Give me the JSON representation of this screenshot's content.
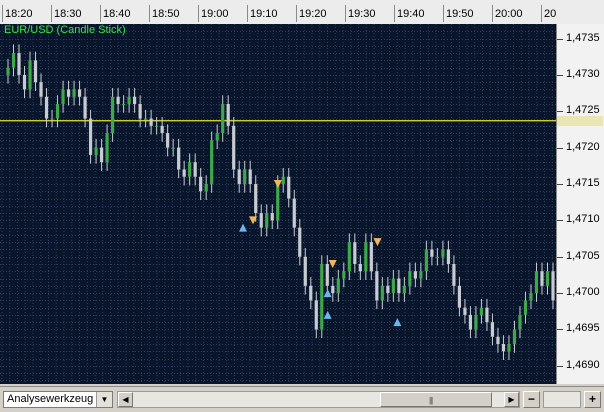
{
  "toolbar": {
    "analysis_tool": "Analysewerkzeug"
  },
  "colors": {
    "background": "#08152b",
    "grid": "#2e3e5c",
    "bull": "#3ea84a",
    "bear": "#c8ccd2",
    "hline": "#e6e62a",
    "title": "#3fe23f",
    "arrow_up": "#6fb4ec",
    "arrow_down": "#f0b65a"
  },
  "chart_data": {
    "type": "candlestick",
    "title": "EUR/USD (Candle Stick)",
    "x_ticks": [
      "18:20",
      "18:30",
      "18:40",
      "18:50",
      "19:00",
      "19:10",
      "19:20",
      "19:30",
      "19:40",
      "19:50",
      "20:00",
      "20"
    ],
    "y_ticks": [
      "1,4735",
      "1,4730",
      "1,4725",
      "1,4720",
      "1,4715",
      "1,4710",
      "1,4705",
      "1,4700",
      "1,4695",
      "1,4690"
    ],
    "ylim": [
      1.46875,
      1.4737
    ],
    "time_range": [
      "18:20",
      "20:00"
    ],
    "horizontal_line": 1.47237,
    "grid": true,
    "close": [
      1.4731,
      1.4733,
      1.473,
      1.4728,
      1.4732,
      1.4729,
      1.4727,
      1.4724,
      1.4724,
      1.4726,
      1.4728,
      1.4727,
      1.4728,
      1.4727,
      1.4724,
      1.4719,
      1.472,
      1.4718,
      1.4722,
      1.4727,
      1.4726,
      1.4726,
      1.4727,
      1.4726,
      1.4724,
      1.4724,
      1.4723,
      1.4723,
      1.4722,
      1.472,
      1.472,
      1.4717,
      1.4716,
      1.4718,
      1.4716,
      1.4714,
      1.4715,
      1.4721,
      1.4722,
      1.4726,
      1.4723,
      1.4717,
      1.4715,
      1.4717,
      1.4715,
      1.4711,
      1.4709,
      1.4711,
      1.471,
      1.4715,
      1.4716,
      1.4713,
      1.4709,
      1.4705,
      1.4701,
      1.4699,
      1.4695,
      1.4704,
      1.4701,
      1.47,
      1.4702,
      1.4703,
      1.4707,
      1.4704,
      1.4703,
      1.4707,
      1.4703,
      1.4699,
      1.4701,
      1.47,
      1.4702,
      1.47,
      1.4701,
      1.4703,
      1.4702,
      1.4703,
      1.4706,
      1.4705,
      1.4705,
      1.4706,
      1.4704,
      1.4701,
      1.4698,
      1.4697,
      1.4695,
      1.4697,
      1.4698,
      1.4696,
      1.4694,
      1.4693,
      1.4692,
      1.4693,
      1.4695,
      1.4697,
      1.4699,
      1.47,
      1.4703,
      1.4701,
      1.4703,
      1.4699
    ],
    "signals_up": [
      {
        "time": "19:08",
        "price": 1.4709
      },
      {
        "time": "19:25",
        "price": 1.47
      },
      {
        "time": "19:25",
        "price": 1.4697
      },
      {
        "time": "19:39",
        "price": 1.4696
      }
    ],
    "signals_down": [
      {
        "time": "19:10",
        "price": 1.471
      },
      {
        "time": "19:15",
        "price": 1.4715
      },
      {
        "time": "19:26",
        "price": 1.4704
      },
      {
        "time": "19:35",
        "price": 1.4707
      }
    ]
  }
}
